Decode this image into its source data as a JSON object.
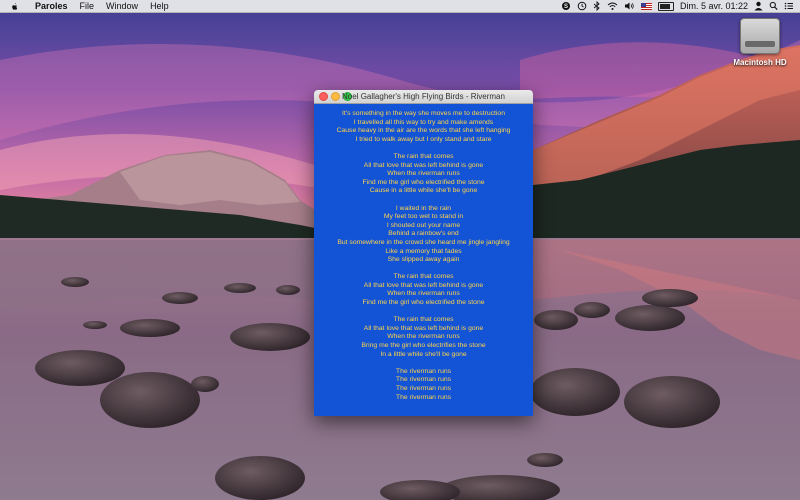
{
  "menubar": {
    "apple_icon": "apple-logo-icon",
    "app_name": "Paroles",
    "menus": [
      "File",
      "Window",
      "Help"
    ],
    "status_icons": [
      "skype-icon",
      "time-machine-icon",
      "bluetooth-icon",
      "wifi-icon",
      "volume-icon",
      "us-flag-icon",
      "battery-icon"
    ],
    "clock": "Dim. 5 avr.  01:22",
    "user_icon": "user-icon",
    "spotlight_icon": "search-icon",
    "list_icon": "notification-list-icon"
  },
  "desktop": {
    "disk_label": "Macintosh HD"
  },
  "window": {
    "title": "Noel Gallagher's High Flying Birds - Riverman",
    "background_color": "#1353d6",
    "text_color": "#ffd54a",
    "stanzas": [
      [
        "It's something in the way she moves me to destruction",
        "I travelled all this way to try and make amends",
        "Cause heavy in the air are the words that she left hanging",
        "I tried to walk away but I only stand and stare"
      ],
      [
        "The rain that comes",
        "All that love that was left behind is gone",
        "When the riverman runs",
        "Find me the girl who electrified the stone",
        "Cause in a little while she'll be gone"
      ],
      [
        "I waited in the rain",
        "My feet too wet to stand in",
        "I shouted out your name",
        "Behind a rainbow's end",
        "But somewhere in the crowd she heard me jingle jangling",
        "Like a memory that fades",
        "She slipped away again"
      ],
      [
        "The rain that comes",
        "All that love that was left behind is gone",
        "When the riverman runs",
        "Find me the girl who electrified the stone"
      ],
      [
        "The rain that comes",
        "All that love that was left behind is gone",
        "When the riverman runs",
        "Bring me the girl who electrifies the stone",
        "In a little while she'll be gone"
      ],
      [
        "The riverman runs",
        "The riverman runs",
        "The riverman runs",
        "The riverman runs"
      ]
    ]
  }
}
